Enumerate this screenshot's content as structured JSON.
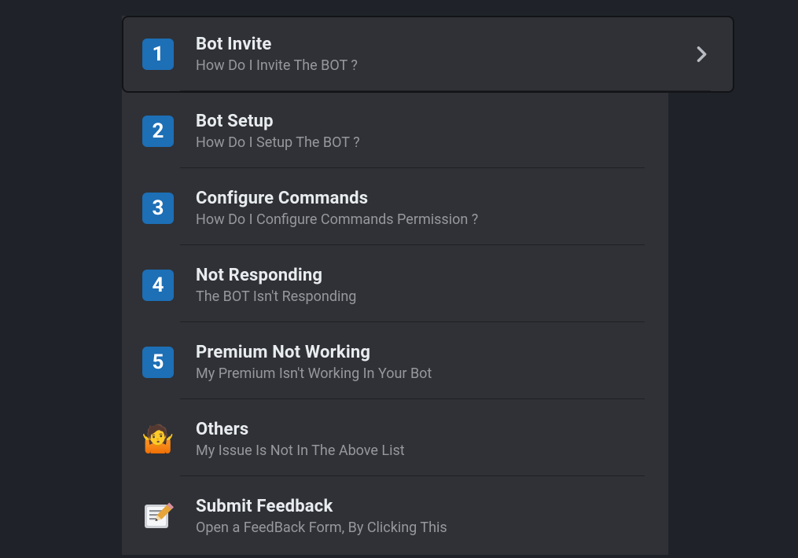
{
  "menu": {
    "selected_index": 0,
    "items": [
      {
        "icon_kind": "number",
        "icon": "1",
        "title": "Bot Invite",
        "subtitle": "How Do I Invite The BOT ?"
      },
      {
        "icon_kind": "number",
        "icon": "2",
        "title": "Bot Setup",
        "subtitle": "How Do I Setup The BOT ?"
      },
      {
        "icon_kind": "number",
        "icon": "3",
        "title": "Configure Commands",
        "subtitle": "How Do I Configure Commands Permission ?"
      },
      {
        "icon_kind": "number",
        "icon": "4",
        "title": "Not Responding",
        "subtitle": "The BOT Isn't Responding"
      },
      {
        "icon_kind": "number",
        "icon": "5",
        "title": "Premium Not Working",
        "subtitle": "My Premium Isn't Working In Your Bot"
      },
      {
        "icon_kind": "emoji",
        "icon": "🤷",
        "title": "Others",
        "subtitle": "My Issue Is Not In The Above List"
      },
      {
        "icon_kind": "feedback",
        "icon": "✏️",
        "title": "Submit Feedback",
        "subtitle": "Open a FeedBack Form, By Clicking This"
      }
    ]
  }
}
